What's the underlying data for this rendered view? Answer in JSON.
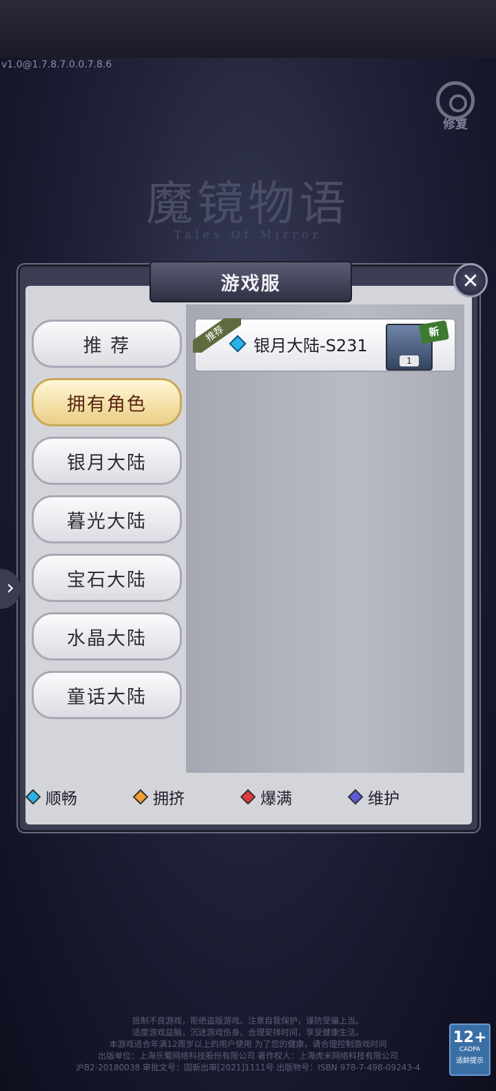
{
  "version": "v1.0@1.7.8.7.0.0.7.8.6",
  "repair_label": "修复",
  "logo": {
    "title_cn": "魔镜物语",
    "title_en": "Tales Of Mirror"
  },
  "dialog": {
    "title": "游戏服",
    "close_icon": "close-icon"
  },
  "sidebar": {
    "items": [
      {
        "label": "推 荐",
        "active": false
      },
      {
        "label": "拥有角色",
        "active": true
      },
      {
        "label": "银月大陆",
        "active": false
      },
      {
        "label": "暮光大陆",
        "active": false
      },
      {
        "label": "宝石大陆",
        "active": false
      },
      {
        "label": "水晶大陆",
        "active": false
      },
      {
        "label": "童话大陆",
        "active": false
      }
    ]
  },
  "server": {
    "ribbon": "推荐",
    "name": "银月大陆-S231",
    "status_color": "#2ab1e6",
    "avatar_level": "1",
    "new_badge": "新"
  },
  "legend": [
    {
      "label": "顺畅",
      "color": "#2ab1e6"
    },
    {
      "label": "拥挤",
      "color": "#f0a030"
    },
    {
      "label": "爆满",
      "color": "#e03a3a"
    },
    {
      "label": "维护",
      "color": "#5a5ad6"
    }
  ],
  "footer": {
    "lines": [
      "抵制不良游戏，拒绝盗版游戏。注意自我保护，谨防受骗上当。",
      "适度游戏益脑，沉迷游戏伤身。合理安排时间，享受健康生活。",
      "本游戏适合年满12周岁以上的用户使用 为了您的健康，请合理控制游戏时间",
      "出版单位：上海乐蜀网络科技股份有限公司 著作权人：上海虎米网络科技有限公司",
      "沪B2-20180038 审批文号：国新出审[2021]1111号 出版物号：ISBN 978-7-498-09243-4"
    ]
  },
  "age_badge": {
    "number": "12+",
    "org": "CADPA",
    "text": "适龄提示"
  }
}
